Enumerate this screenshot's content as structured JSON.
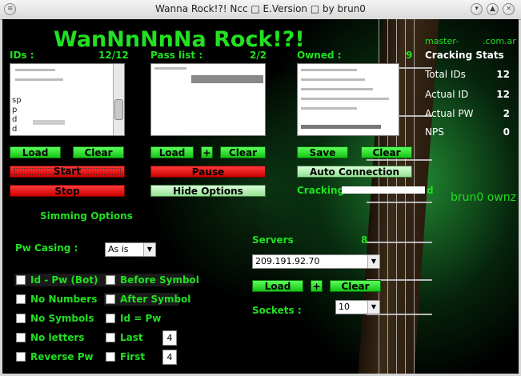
{
  "window": {
    "title": "Wanna Rock!?! Ncc □ E.Version □ by brun0"
  },
  "heading": "WanNnNnNa Rock!?!",
  "ids": {
    "label": "IDs :",
    "count": "12/12",
    "rows": [
      "",
      "",
      "",
      "sp",
      "p",
      "d",
      "d"
    ],
    "load": "Load",
    "clear": "Clear"
  },
  "pass": {
    "label": "Pass list :",
    "count": "2/2",
    "load": "Load",
    "plus": "+",
    "clear": "Clear"
  },
  "owned": {
    "label": "Owned :",
    "count": "9",
    "save": "Save",
    "clear": "Clear"
  },
  "master": "master-",
  "master_suffix": ".com.ar",
  "stats": {
    "title": "Cracking Stats",
    "rows": [
      {
        "label": "Total IDs",
        "value": "12"
      },
      {
        "label": "Actual ID",
        "value": "12"
      },
      {
        "label": "Actual PW",
        "value": "2"
      },
      {
        "label": "NPS",
        "value": "0"
      }
    ]
  },
  "controls": {
    "start": "Start",
    "stop": "Stop",
    "pause": "Pause",
    "hide_options": "Hide Options",
    "auto_connection": "Auto Connection",
    "cracking_label": "Cracking :",
    "cracking_suffix": "d"
  },
  "brun0": "brun0 ownz",
  "simming": {
    "title": "Simming Options",
    "pw_casing_label": "Pw Casing :",
    "pw_casing_value": "As is",
    "left_options": [
      "Id - Pw (Bot)",
      "No Numbers",
      "No Symbols",
      "No letters",
      "Reverse Pw"
    ],
    "right_options": [
      "Before Symbol",
      "After Symbol",
      "Id = Pw",
      "Last",
      "First"
    ],
    "last_value": "4",
    "first_value": "4"
  },
  "servers": {
    "label": "Servers",
    "count": "8",
    "value": "209.191.92.70",
    "load": "Load",
    "plus": "+",
    "clear": "Clear",
    "sockets_label": "Sockets :",
    "sockets_value": "10"
  }
}
